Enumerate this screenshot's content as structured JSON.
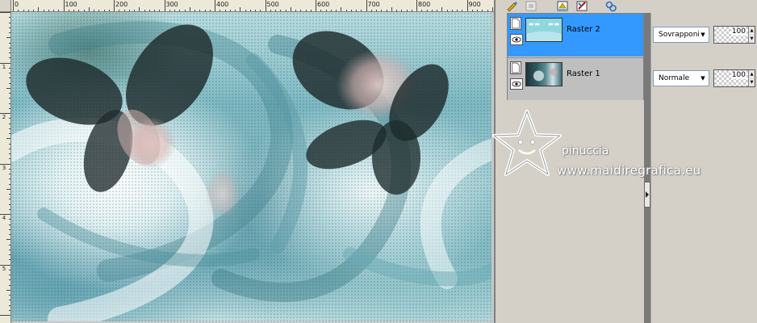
{
  "ruler": {
    "top_labels": [
      "0",
      "100",
      "200",
      "300",
      "400",
      "500",
      "600",
      "700",
      "800",
      "900"
    ],
    "left_labels": [
      "1",
      "2",
      "3",
      "4",
      "5"
    ]
  },
  "layers": {
    "toolbar": {
      "icons": [
        "new-layer-icon",
        "mask-icon",
        "layer-properties-icon",
        "merge-icon",
        "link-icon"
      ]
    },
    "items": [
      {
        "name": "Raster 2",
        "blend_mode": "Sovrapponi",
        "opacity": "100",
        "selected": true,
        "thumb_color": "#8fd7df"
      },
      {
        "name": "Raster 1",
        "blend_mode": "Normale",
        "opacity": "100",
        "selected": false
      }
    ],
    "selected_color": "#3399ff"
  },
  "watermark": {
    "name": "pinuccia",
    "url": "www.maidiregrafica.eu"
  },
  "colors": {
    "canvas_teal": "#7fb9c3",
    "flower_dark": "#1e2b2c"
  }
}
